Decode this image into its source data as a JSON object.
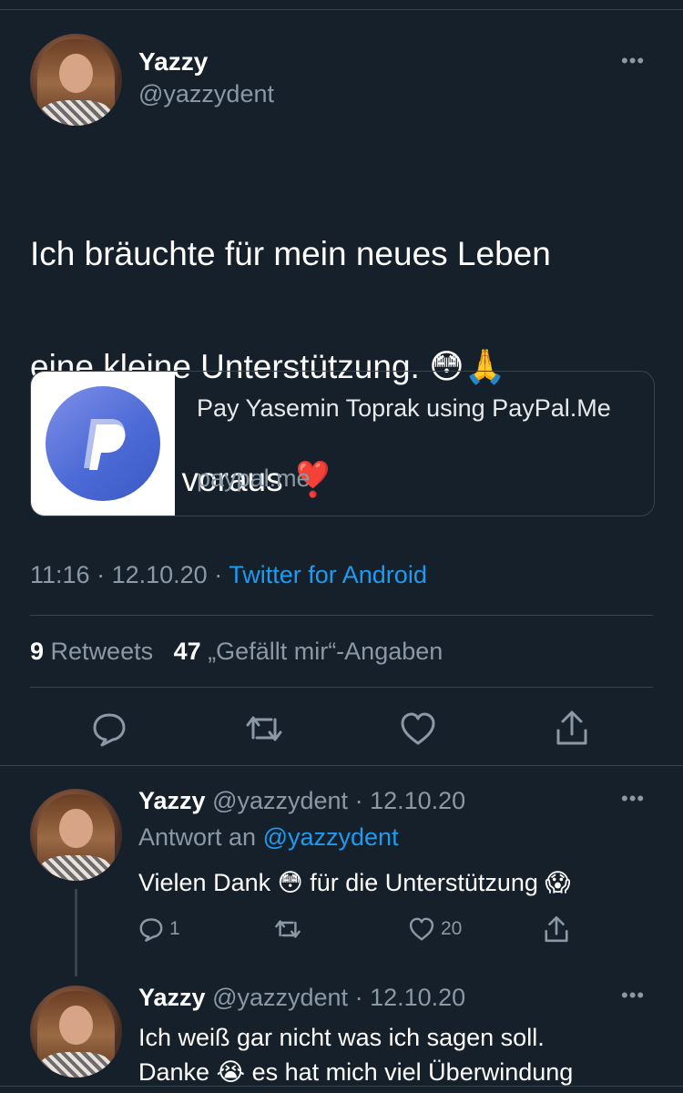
{
  "tweet": {
    "author_name": "Yazzy",
    "author_handle": "@yazzydent",
    "text_line1": "Ich bräuchte für mein neues Leben",
    "text_line2": "eine kleine Unterstützung. 😳🙏",
    "text_line3": "Danke im voraus ❣️",
    "card": {
      "title": "Pay Yasemin Toprak using PayPal.Me",
      "domain": "paypal.me",
      "logo_icon": "paypal-icon"
    },
    "time": "11:16",
    "date": "12.10.20",
    "separator": "·",
    "source": "Twitter for Android",
    "retweets_count": "9",
    "retweets_label": "Retweets",
    "likes_count": "47",
    "likes_label": "„Gefällt mir“-Angaben",
    "actions": [
      "reply-icon",
      "retweet-icon",
      "like-icon",
      "share-icon"
    ]
  },
  "replies": [
    {
      "author_name": "Yazzy",
      "author_handle": "@yazzydent",
      "date": "· 12.10.20",
      "reply_to_label": "Antwort an",
      "reply_to_handle": "@yazzydent",
      "text": "Vielen Dank 😳 für die Unterstützung 😱",
      "reply_count": "1",
      "like_count": "20"
    },
    {
      "author_name": "Yazzy",
      "author_handle": "@yazzydent",
      "date": "· 12.10.20",
      "text_line1": "Ich weiß gar nicht was ich sagen soll.",
      "text_line2": "Danke 😭 es hat mich viel Überwindung"
    }
  ],
  "colors": {
    "background": "#15202b",
    "text": "#ffffff",
    "secondary": "#8b98a5",
    "link": "#1d9bf0",
    "border": "#38444d"
  }
}
